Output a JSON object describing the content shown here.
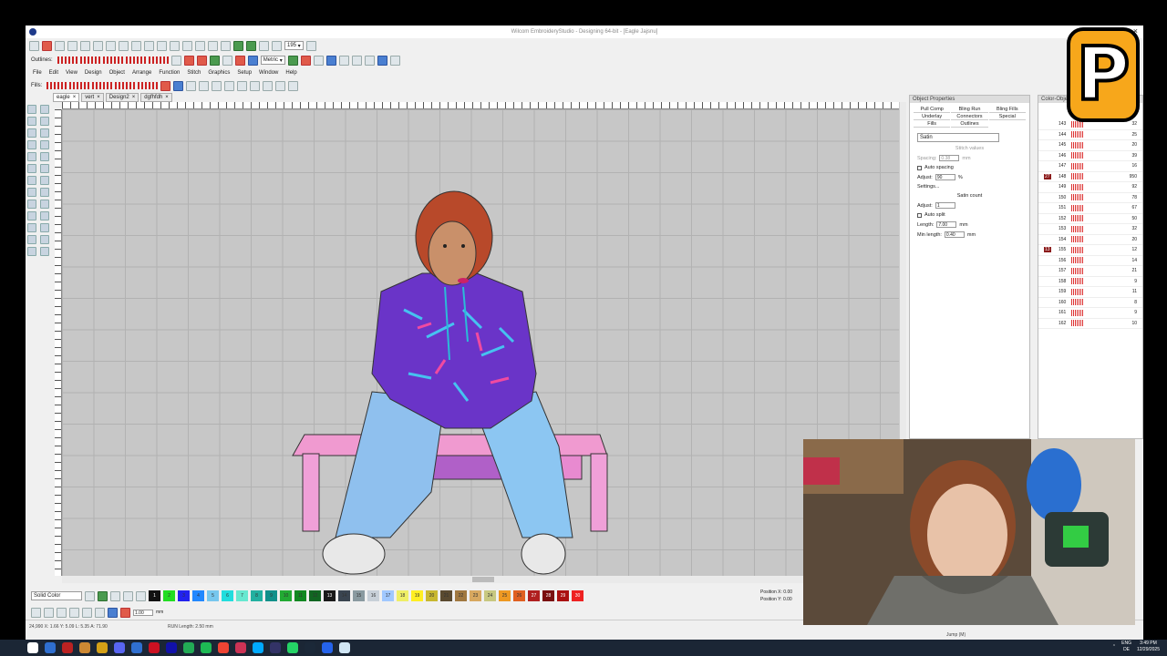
{
  "window": {
    "title": "Wilcom EmbroideryStudio - Designing 64-bit - [Eagle     Jajsnu]",
    "close": "×"
  },
  "toolbar": {
    "zoom": "195",
    "outlines_label": "Outlines:",
    "fills_label": "Fills:",
    "units": "Metric"
  },
  "menu": [
    "File",
    "Edit",
    "View",
    "Design",
    "Object",
    "Arrange",
    "Function",
    "Stitch",
    "Graphics",
    "Setup",
    "Window",
    "Help"
  ],
  "doc_tabs": [
    {
      "label": "eagle",
      "close": "×"
    },
    {
      "label": "vert",
      "close": "×"
    },
    {
      "label": "Design2",
      "close": "×"
    },
    {
      "label": "dgfhfdh",
      "close": "×"
    }
  ],
  "object_properties": {
    "title": "Object Properties",
    "tabs": [
      "Pull Comp",
      "Bling Run",
      "Bling Fills",
      "Underlay",
      "Connectors",
      "Special",
      "Fills",
      "Outlines"
    ],
    "fill_type": "Satin",
    "stitch_values": "Stitch values",
    "spacing_label": "Spacing:",
    "spacing_value": "0.38",
    "spacing_unit": "mm",
    "auto_spacing": "Auto spacing",
    "adjust_label": "Adjust:",
    "adjust_value": "90",
    "adjust_unit": "%",
    "settings": "Settings...",
    "satin_count": "Satin count",
    "satin_adjust_label": "Adjust:",
    "satin_adjust_value": "1",
    "auto_split": "Auto split",
    "length_label": "Length:",
    "length_value": "7.00",
    "length_unit": "mm",
    "minlength_label": "Min length:",
    "minlength_value": "0.40",
    "minlength_unit": "mm"
  },
  "color_object_list": {
    "title": "Color-Object List",
    "rows": [
      {
        "id": "143",
        "count": "32"
      },
      {
        "id": "144",
        "count": "25"
      },
      {
        "id": "145",
        "count": "20"
      },
      {
        "id": "146",
        "count": "39"
      },
      {
        "id": "147",
        "count": "16"
      },
      {
        "id": "148",
        "count": "950",
        "badge": "27"
      },
      {
        "id": "149",
        "count": "92"
      },
      {
        "id": "150",
        "count": "78"
      },
      {
        "id": "151",
        "count": "67"
      },
      {
        "id": "152",
        "count": "50"
      },
      {
        "id": "153",
        "count": "32"
      },
      {
        "id": "154",
        "count": "20"
      },
      {
        "id": "155",
        "count": "12",
        "badge": "13"
      },
      {
        "id": "156",
        "count": "14"
      },
      {
        "id": "157",
        "count": "21"
      },
      {
        "id": "158",
        "count": "9"
      },
      {
        "id": "159",
        "count": "11"
      },
      {
        "id": "160",
        "count": "8"
      },
      {
        "id": "161",
        "count": "9"
      },
      {
        "id": "162",
        "count": "10"
      }
    ]
  },
  "palette": {
    "mode": "Solid Color",
    "swatches": [
      {
        "n": "1",
        "c": "#111111"
      },
      {
        "n": "2",
        "c": "#22dd22"
      },
      {
        "n": "3",
        "c": "#2222ee"
      },
      {
        "n": "4",
        "c": "#2288ff"
      },
      {
        "n": "5",
        "c": "#77c7ee"
      },
      {
        "n": "6",
        "c": "#22dddd"
      },
      {
        "n": "7",
        "c": "#66e8d0"
      },
      {
        "n": "8",
        "c": "#22b0a0"
      },
      {
        "n": "9",
        "c": "#11908a"
      },
      {
        "n": "10",
        "c": "#22aa33"
      },
      {
        "n": "11",
        "c": "#118822"
      },
      {
        "n": "12",
        "c": "#116622"
      },
      {
        "n": "13",
        "c": "#1a1a1a"
      },
      {
        "n": "14",
        "c": "#3a4450"
      },
      {
        "n": "15",
        "c": "#8a9aa0"
      },
      {
        "n": "16",
        "c": "#c8d0d8"
      },
      {
        "n": "17",
        "c": "#a0c8ff"
      },
      {
        "n": "18",
        "c": "#eeee66"
      },
      {
        "n": "19",
        "c": "#ffee22"
      },
      {
        "n": "20",
        "c": "#c8b830"
      },
      {
        "n": "21",
        "c": "#5a4a30"
      },
      {
        "n": "22",
        "c": "#a07840"
      },
      {
        "n": "23",
        "c": "#d8a860"
      },
      {
        "n": "24",
        "c": "#c8c880"
      },
      {
        "n": "25",
        "c": "#ee9922"
      },
      {
        "n": "26",
        "c": "#e06020"
      },
      {
        "n": "27",
        "c": "#b02020"
      },
      {
        "n": "28",
        "c": "#7a1010"
      },
      {
        "n": "29",
        "c": "#aa1111"
      },
      {
        "n": "30",
        "c": "#ee2222"
      }
    ]
  },
  "position": {
    "x_label": "Position X:",
    "y_label": "Position Y:",
    "x": "0.00",
    "y": "0.00"
  },
  "bottom_toolbar": {
    "size": "1.00",
    "unit": "mm"
  },
  "status": {
    "coords": "24,990    X: 1.66 Y: 5.09 L: 5.35 A: 71.90",
    "run_length": "RUN Length: 2.50 mm",
    "jump": "Jump (M)"
  },
  "logo_letter": "P",
  "taskbar": {
    "lang": "ENG",
    "region": "DE",
    "time": "3:49 PM",
    "date": "12/29/2025",
    "icon_colors": [
      "#ffffff",
      "#2f6fd0",
      "#b22",
      "#c83",
      "#d4a017",
      "#5865f2",
      "#2f6fd0",
      "#c12",
      "#11a",
      "#2a5",
      "#1db954",
      "#e43",
      "#c35",
      "#0af",
      "#336",
      "#25d366",
      "#1b2838",
      "#2563eb",
      "#d0e6f5"
    ]
  }
}
